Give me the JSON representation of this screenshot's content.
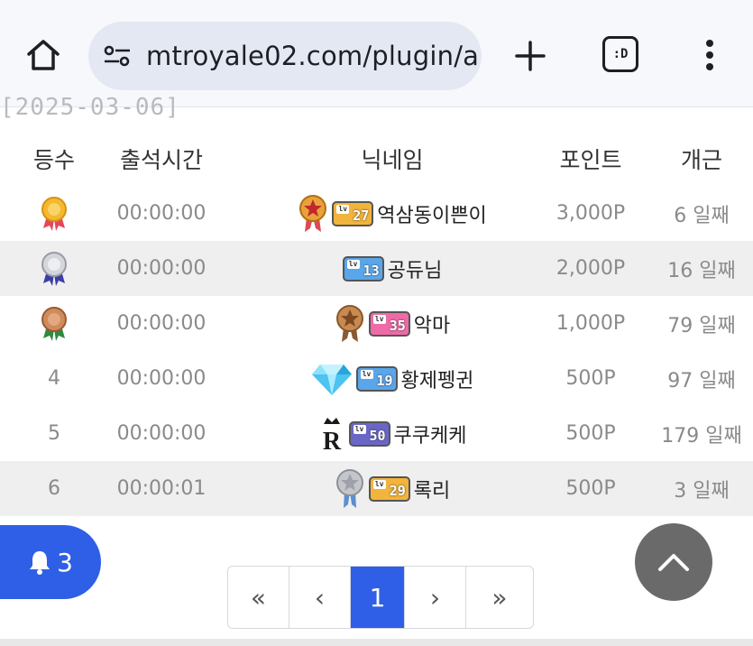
{
  "browser": {
    "url": "mtroyale02.com/plugin/a",
    "tabs_label": ":D",
    "icons": {
      "home": "home-icon",
      "site_settings": "tune-icon",
      "new_tab": "plus-icon",
      "tabs": "tab-switcher-icon",
      "menu": "more-vert-icon"
    },
    "accent": "#3b6fe0"
  },
  "peek_text": "[2025-03-06]",
  "table": {
    "headers": {
      "rank": "등수",
      "time": "출석시간",
      "nickname": "닉네임",
      "points": "포인트",
      "days": "개근"
    },
    "rows": [
      {
        "rank": "",
        "medal": "gold",
        "time": "00:00:00",
        "level": "27",
        "level_color": "#f2b43b",
        "badge": "gold-star-medal",
        "nickname": "역삼동이쁜이",
        "points": "3,000P",
        "days": "6 일째"
      },
      {
        "rank": "",
        "medal": "silver",
        "time": "00:00:00",
        "level": "13",
        "level_color": "#5aa6ea",
        "badge": "",
        "nickname": "공듀님",
        "points": "2,000P",
        "days": "16 일째"
      },
      {
        "rank": "",
        "medal": "bronze",
        "time": "00:00:00",
        "level": "35",
        "level_color": "#ee6aa8",
        "badge": "bronze-star-medal",
        "nickname": "악마",
        "points": "1,000P",
        "days": "79 일째"
      },
      {
        "rank": "4",
        "medal": "",
        "time": "00:00:00",
        "level": "19",
        "level_color": "#5aa6ea",
        "badge": "diamond",
        "nickname": "황제펭귄",
        "points": "500P",
        "days": "97 일째"
      },
      {
        "rank": "5",
        "medal": "",
        "time": "00:00:00",
        "level": "50",
        "level_color": "#6a66c8",
        "badge": "crown-r",
        "nickname": "쿠쿠케케",
        "points": "500P",
        "days": "179 일째"
      },
      {
        "rank": "6",
        "medal": "",
        "time": "00:00:01",
        "level": "29",
        "level_color": "#f2b43b",
        "badge": "silver-star-medal",
        "nickname": "록리",
        "points": "500P",
        "days": "3 일째"
      }
    ]
  },
  "notification": {
    "count": "3",
    "icon": "bell-icon"
  },
  "scroll_top": {
    "icon": "chevron-up-icon"
  },
  "pagination": {
    "first": "«",
    "prev": "‹",
    "current": "1",
    "next": "›",
    "last": "»"
  },
  "colors": {
    "primary": "#2f5fe6",
    "row_shade": "#efefef"
  }
}
